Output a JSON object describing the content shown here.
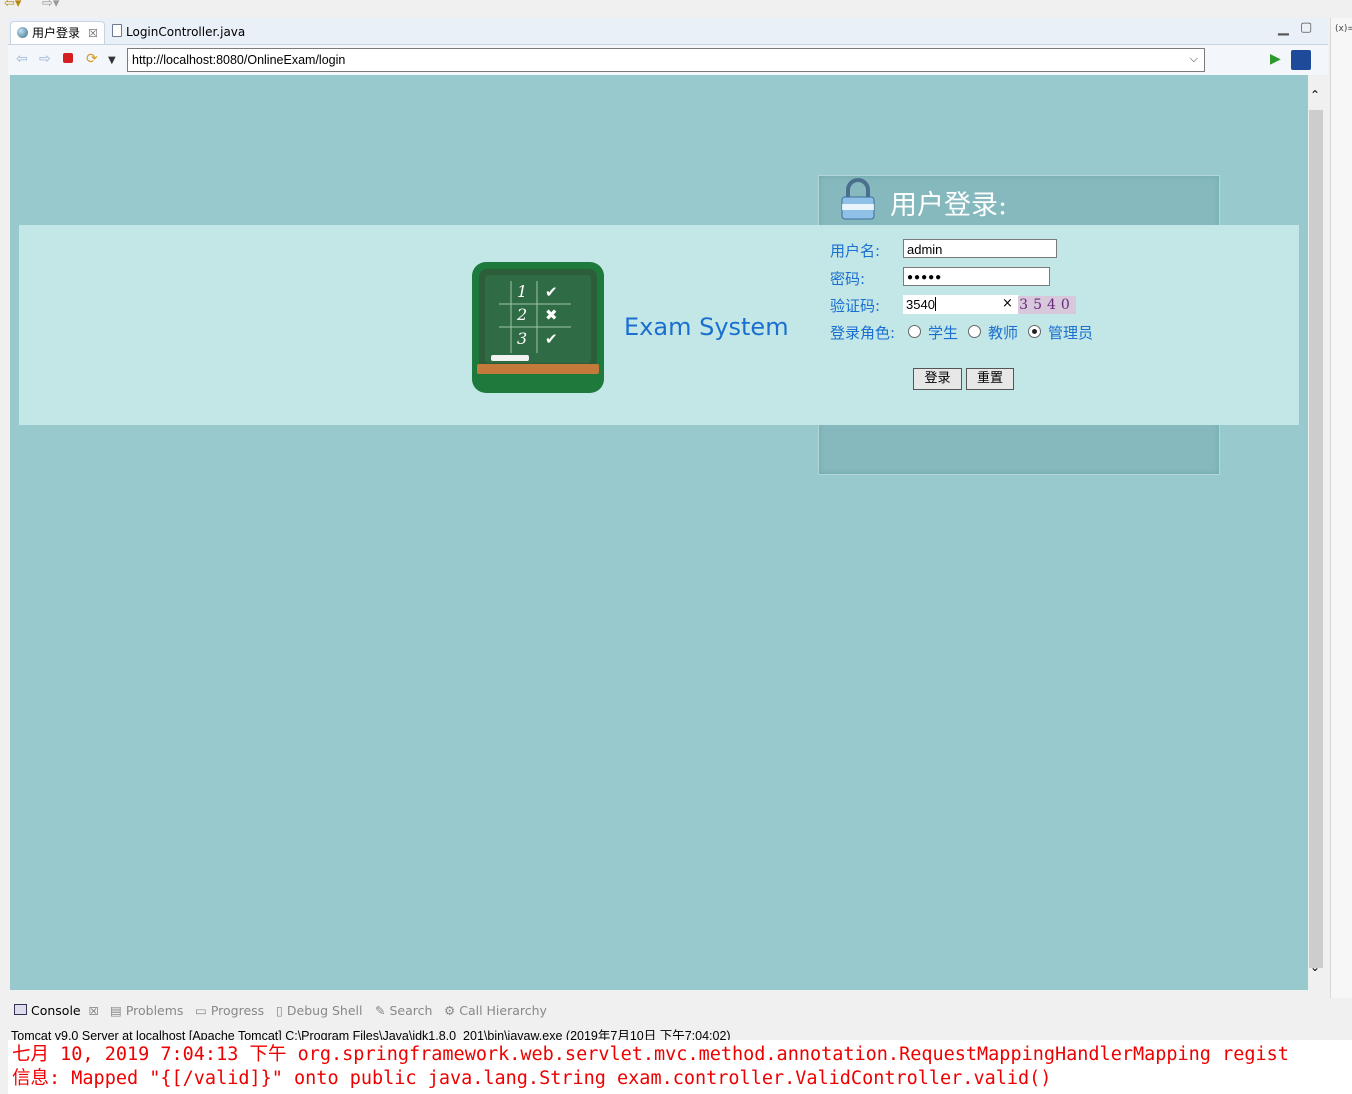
{
  "tabs": [
    {
      "label": "用户登录",
      "active": true,
      "icon": "globe-icon"
    },
    {
      "label": "LoginController.java",
      "active": false,
      "icon": "java-file-icon"
    }
  ],
  "url": "http://localhost:8080/OnlineExam/login",
  "page": {
    "logo_text": "Exam System",
    "login_title": "用户登录:",
    "username_label": "用户名:",
    "username_value": "admin",
    "password_label": "密码:",
    "password_value": "●●●●●",
    "captcha_label": "验证码:",
    "captcha_value": "3540",
    "captcha_clear": "×",
    "captcha_image_text": "3540",
    "role_label": "登录角色:",
    "roles": [
      {
        "label": "学生",
        "checked": false
      },
      {
        "label": "教师",
        "checked": false
      },
      {
        "label": "管理员",
        "checked": true
      }
    ],
    "login_button": "登录",
    "reset_button": "重置"
  },
  "console": {
    "tabs": [
      "Console",
      "Problems",
      "Progress",
      "Debug Shell",
      "Search",
      "Call Hierarchy"
    ],
    "header": "Tomcat v9.0 Server at localhost [Apache Tomcat] C:\\Program Files\\Java\\jdk1.8.0_201\\bin\\javaw.exe (2019年7月10日 下午7:04:02)",
    "lines": [
      "七月 10, 2019 7:04:13 下午 org.springframework.web.servlet.mvc.method.annotation.RequestMappingHandlerMapping regist",
      "信息: Mapped \"{[/valid]}\" onto public java.lang.String exam.controller.ValidController.valid()"
    ]
  },
  "right_edge_text": "(x)="
}
